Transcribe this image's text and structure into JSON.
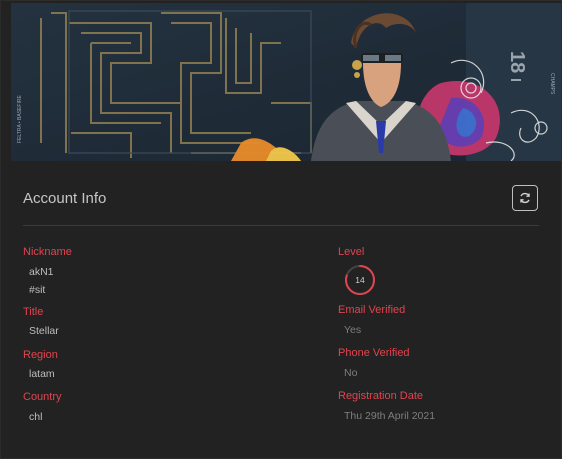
{
  "banner": {
    "number_label": "18",
    "vertical_text_left": "FELTRA • BASEFIRE",
    "vertical_text_right": "CHAMPS",
    "watermark_text": "CHAMPS"
  },
  "account": {
    "title": "Account Info",
    "nickname_label": "Nickname",
    "nickname": "akN1",
    "tag": "#sit",
    "title_label": "Title",
    "title_value": "Stellar",
    "region_label": "Region",
    "region_value": "latam",
    "country_label": "Country",
    "country_value": "chl",
    "level_label": "Level",
    "level_value": "14",
    "level_progress": 0.8,
    "email_label": "Email Verified",
    "email_value": "Yes",
    "phone_label": "Phone Verified",
    "phone_value": "No",
    "registration_label": "Registration Date",
    "registration_value": "Thu 29th April 2021"
  },
  "colors": {
    "accent": "#e0444e",
    "panel": "#232223",
    "banner_bg": "#1e2a35"
  },
  "icons": {
    "refresh": "refresh-icon"
  }
}
